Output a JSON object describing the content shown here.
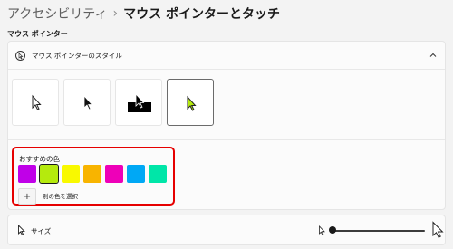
{
  "breadcrumb": {
    "parent": "アクセシビリティ",
    "separator": "›",
    "current": "マウス ポインターとタッチ"
  },
  "section": {
    "label": "マウス ポインター"
  },
  "pointer_style": {
    "header_label": "マウス ポインターのスタイル",
    "selected_index": 3
  },
  "recommended": {
    "title": "おすすめの色",
    "colors": [
      "#c000e8",
      "#b5ea0d",
      "#f9f900",
      "#f8b400",
      "#ee00b8",
      "#00a8f5",
      "#00e6a8"
    ],
    "selected_index": 1,
    "custom_icon": "+",
    "custom_label": "別の色を選択"
  },
  "size": {
    "label": "サイズ",
    "value_fraction": 0.02
  },
  "colors": {
    "accent_highlight": "#e60000",
    "selected_pointer_color": "#b5ea0d"
  }
}
